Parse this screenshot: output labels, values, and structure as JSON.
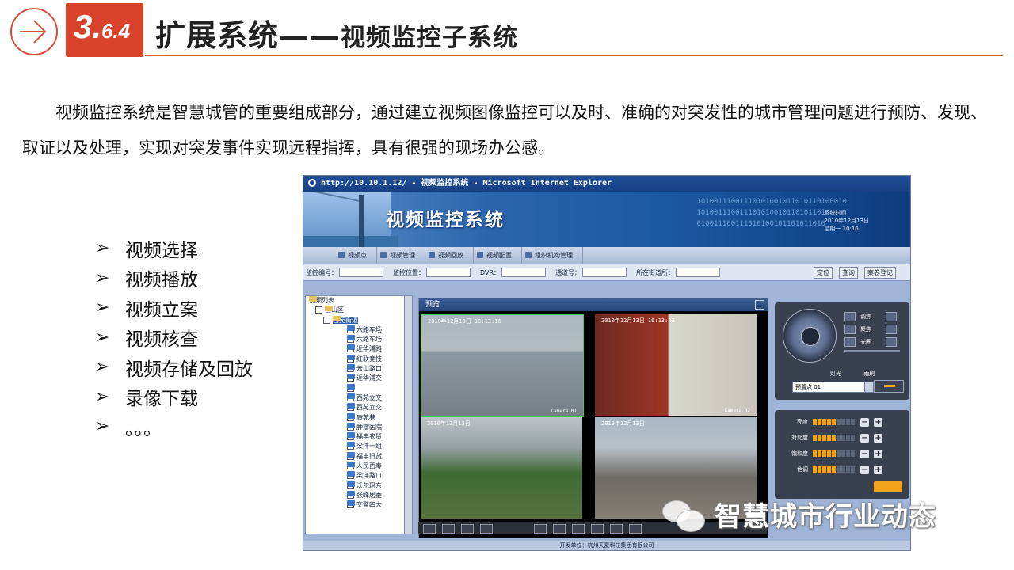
{
  "header": {
    "section_number_big": "3.",
    "section_number_small": "6.4",
    "title_main": "扩展系统——",
    "title_sub": "视频监控子系统",
    "accent_color": "#d9432b"
  },
  "intro_text": "视频监控系统是智慧城管的重要组成部分，通过建立视频图像监控可以及时、准确的对突发性的城市管理问题进行预防、发现、取证以及处理，实现对突发事件实现远程指挥，具有很强的现场办公感。",
  "bullets": {
    "arrow": "➢",
    "items": [
      "视频选择",
      "视频播放",
      "视频立案",
      "视频核查",
      "视频存储及回放",
      "录像下载",
      "。。。"
    ]
  },
  "screenshot": {
    "window_title": "http://10.10.1.12/ - 视频监控系统 - Microsoft Internet Explorer",
    "banner_title": "视频监控系统",
    "banner_binary": [
      "10100111001110101001011010110100010",
      "101001110011101010010110101101",
      "010011100111010100101101011010"
    ],
    "banner_date": [
      "系统时间",
      "2010年12月13日",
      "星期一 10:16"
    ],
    "nav": [
      "视频点",
      "视频管理",
      "视频回放",
      "视频配置",
      "组织机构管理"
    ],
    "filters": {
      "code_label": "监控编号：",
      "location_label": "监控位置：",
      "dvr_label": "DVR：",
      "channel_label": "通道号：",
      "office_label": "所在街道所：",
      "locate_button": "定位",
      "query_button": "查询",
      "register_button": "案卷登记"
    },
    "tree": {
      "root": "视频列表",
      "district": "西山区",
      "street": "西苑街道",
      "items": [
        "六路车场",
        "六路车场",
        "近华浦路",
        "红联竞技",
        "云山路口",
        "近华浦交",
        "",
        "西苑立交",
        "西苑立交",
        "康苑巷",
        "肿瘤医院",
        "福丰农贸",
        "梁洋一组",
        "福丰旧货",
        "人民西寿",
        "梁洋路口",
        "沃尔玛东",
        "张峰居委",
        "交警四大"
      ]
    },
    "video_panel": {
      "title": "预览",
      "cams": [
        {
          "stamp": "2010年12月13日  16:13:16",
          "label": "Camera 01"
        },
        {
          "stamp": "2010年12月13日  16:13:23",
          "label": "Camera 02"
        },
        {
          "stamp": "2010年12月13日",
          "label": ""
        },
        {
          "stamp": "2010年12月13日",
          "label": ""
        }
      ]
    },
    "ptz": {
      "zoom_label": "调焦",
      "focus_label": "聚焦",
      "iris_label": "光圈",
      "light_label": "灯光",
      "wiper_label": "雨刷",
      "preset_value": "预置点 01"
    },
    "adjust": {
      "rows": [
        {
          "name": "亮度",
          "level": 5
        },
        {
          "name": "对比度",
          "level": 5
        },
        {
          "name": "饱和度",
          "level": 5
        },
        {
          "name": "色调",
          "level": 5
        }
      ],
      "segments_total": 9,
      "plus": "+",
      "minus": "−"
    },
    "footer": "开发单位：杭州天夏科技集团有限公司"
  },
  "watermark": {
    "text": "智慧城市行业动态"
  }
}
